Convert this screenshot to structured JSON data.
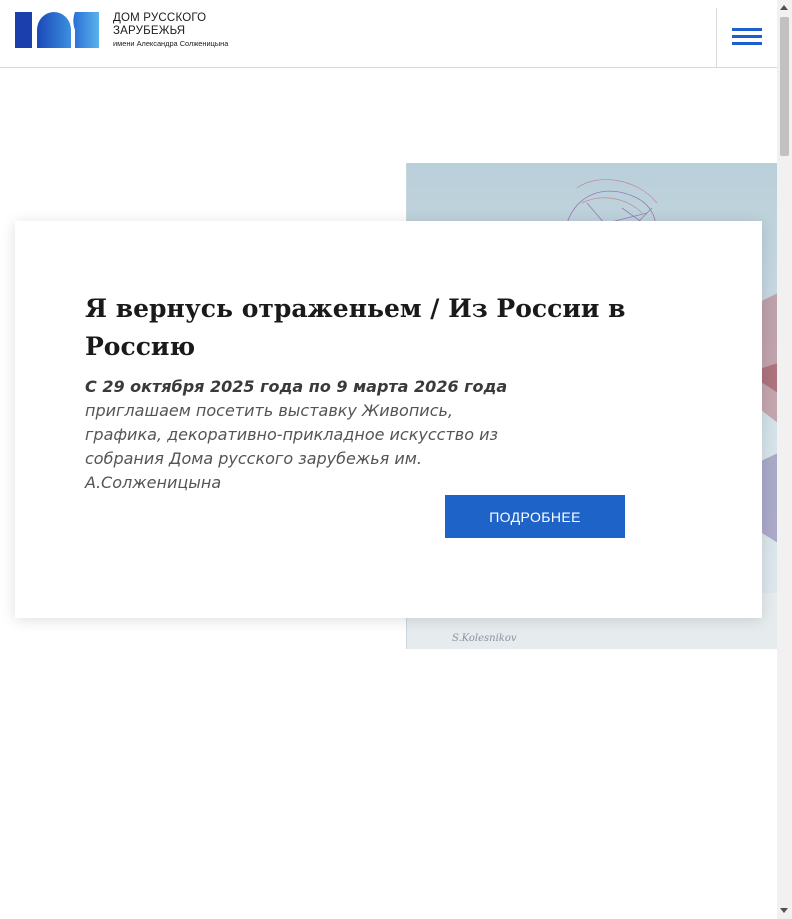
{
  "header": {
    "logo": {
      "line1": "ДОМ РУССКОГО",
      "line2": "ЗАРУБЕЖЬЯ",
      "line3": "имени Александра Солженицына"
    },
    "menu_icon": "hamburger-menu-icon"
  },
  "hero": {
    "title": "Я вернусь отраженьем / Из России в Россию",
    "date": "С 29 октября 2025 года по 9 марта 2026 года",
    "description": "приглашаем посетить выставку Живопись, графика, декоративно-прикладное искусство из собрания Дома русского зарубежья им. А.Солженицына",
    "more_button": "ПОДРОБНЕЕ"
  },
  "colors": {
    "accent": "#1e63c8",
    "menu_icon": "#1e5fcf"
  }
}
